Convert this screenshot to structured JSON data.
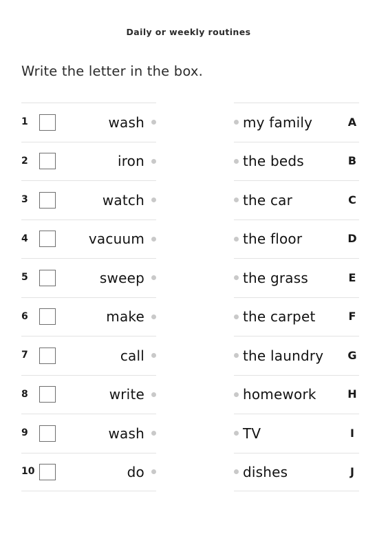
{
  "worksheet": {
    "title": "Daily or weekly routines",
    "instruction": "Write the letter in the box.",
    "left_column": [
      {
        "number": "1",
        "verb": "wash"
      },
      {
        "number": "2",
        "verb": "iron"
      },
      {
        "number": "3",
        "verb": "watch"
      },
      {
        "number": "4",
        "verb": "vacuum"
      },
      {
        "number": "5",
        "verb": "sweep"
      },
      {
        "number": "6",
        "verb": "make"
      },
      {
        "number": "7",
        "verb": "call"
      },
      {
        "number": "8",
        "verb": "write"
      },
      {
        "number": "9",
        "verb": "wash"
      },
      {
        "number": "10",
        "verb": "do"
      }
    ],
    "right_column": [
      {
        "letter": "A",
        "phrase": "my family"
      },
      {
        "letter": "B",
        "phrase": "the beds"
      },
      {
        "letter": "C",
        "phrase": "the car"
      },
      {
        "letter": "D",
        "phrase": "the floor"
      },
      {
        "letter": "E",
        "phrase": "the grass"
      },
      {
        "letter": "F",
        "phrase": "the carpet"
      },
      {
        "letter": "G",
        "phrase": "the laundry"
      },
      {
        "letter": "H",
        "phrase": "homework"
      },
      {
        "letter": "I",
        "phrase": "TV"
      },
      {
        "letter": "J",
        "phrase": "dishes"
      }
    ],
    "answer_values": [
      "",
      "",
      "",
      "",
      "",
      "",
      "",
      "",
      "",
      ""
    ],
    "colors": {
      "page_background": "#ffffff",
      "text": "#121212",
      "title_text": "#2b2b2b",
      "rule_line": "#e2e2e2",
      "checkbox_border": "#6e6e6e",
      "connector_dot": "#c9c9c9"
    }
  }
}
